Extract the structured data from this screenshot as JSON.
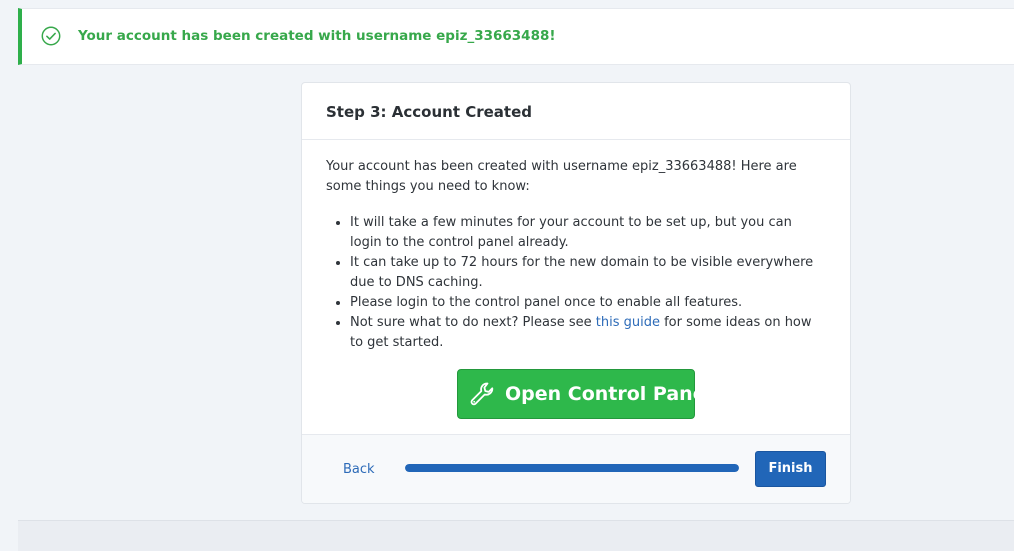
{
  "alert": {
    "icon": "check-circle-icon",
    "message": "Your account has been created with username epiz_33663488!",
    "color": "#37a84b"
  },
  "card": {
    "title": "Step 3: Account Created",
    "intro": "Your account has been created with username epiz_33663488! Here are some things you need to know:",
    "bullets": [
      "It will take a few minutes for your account to be set up, but you can login to the control panel already.",
      "It can take up to 72 hours for the new domain to be visible everywhere due to DNS caching.",
      "Please login to the control panel once to enable all features."
    ],
    "last_bullet": {
      "before": "Not sure what to do next? Please see ",
      "link": "this guide",
      "after": " for some ideas on how to get started."
    },
    "control_panel_button": {
      "label": "Open Control Panel",
      "icon": "wrench-icon",
      "color": "#2eb84b"
    }
  },
  "footer": {
    "back_label": "Back",
    "progress": 1.0,
    "finish_label": "Finish",
    "accent_color": "#2166b8"
  }
}
